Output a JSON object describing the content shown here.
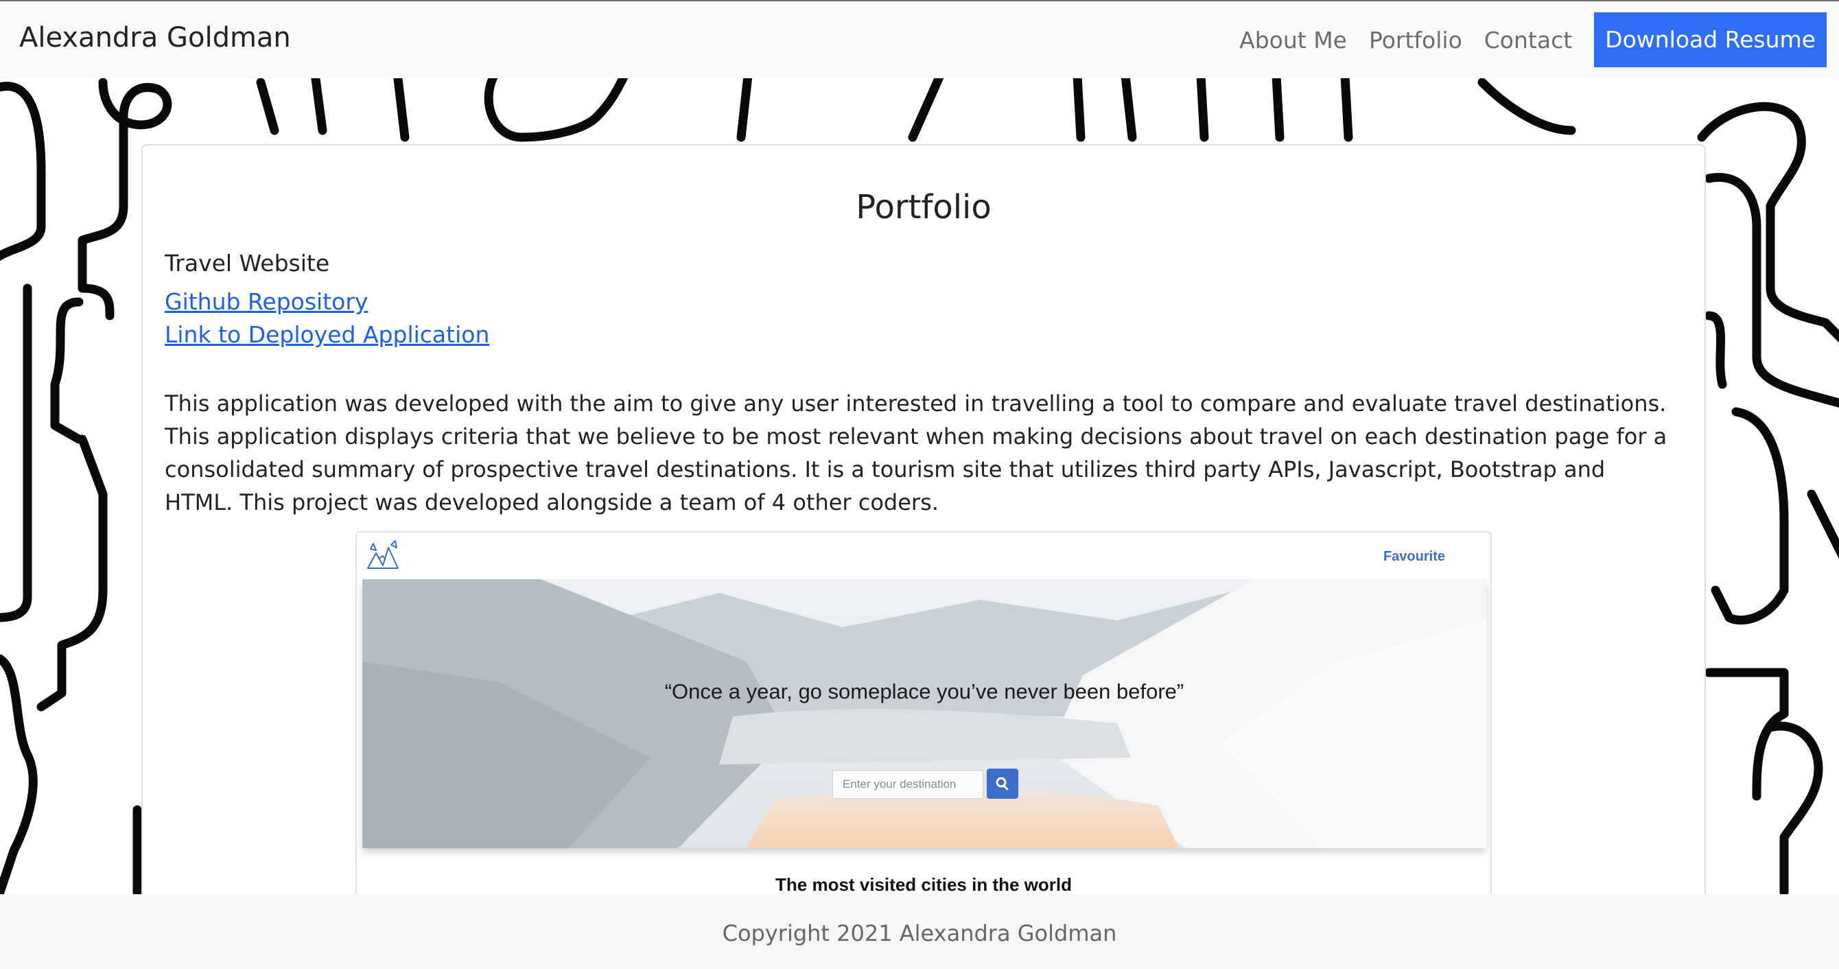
{
  "navbar": {
    "brand": "Alexandra Goldman",
    "links": [
      "About Me",
      "Portfolio",
      "Contact"
    ],
    "cta": "Download Resume",
    "accent_color": "#2f6ff6"
  },
  "main": {
    "title": "Portfolio",
    "project": {
      "title": "Travel Website",
      "repo_link": "Github Repository",
      "deploy_link": "Link to Deployed Application",
      "description": "This application was developed with the aim to give any user interested in travelling a tool to compare and evaluate travel destinations. This application displays criteria that we believe to be most relevant when making decisions about travel on each destination page for a consolidated summary of prospective travel destinations. It is a tourism site that utilizes third party APIs, Javascript, Bootstrap and HTML. This project was developed alongside a team of 4 other coders.",
      "preview": {
        "nav_link": "Favourite",
        "quote": "“Once a year, go someplace you’ve never been before”",
        "search_placeholder": "Enter your destination",
        "subheading": "The most visited cities in the world",
        "logo_icon": "travel-logo-icon",
        "search_icon": "magnifier-icon"
      }
    }
  },
  "footer": {
    "text": "Copyright 2021 Alexandra Goldman"
  }
}
